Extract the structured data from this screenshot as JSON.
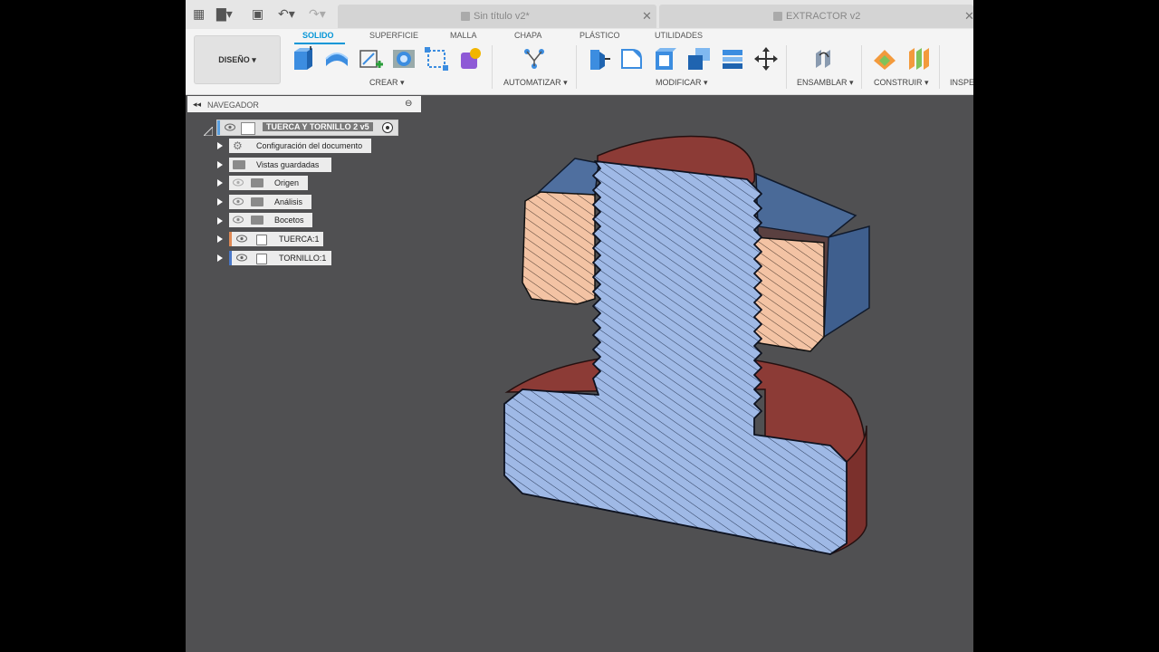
{
  "quick_access": {
    "grid_icon": "grid-icon",
    "file_icon": "file-icon",
    "save_icon": "save-icon",
    "undo_icon": "undo-icon",
    "redo_icon": "redo-icon"
  },
  "tabs": [
    {
      "label": "Sin título v2*",
      "active": false
    },
    {
      "label": "EXTRACTOR v2",
      "active": false
    }
  ],
  "ribbon": {
    "workspace": "DISEÑO",
    "tabs": [
      "SOLIDO",
      "SUPERFICIE",
      "MALLA",
      "CHAPA",
      "PLÁSTICO",
      "UTILIDADES"
    ],
    "active_tab": "SOLIDO",
    "groups": [
      "CREAR",
      "AUTOMATIZAR",
      "MODIFICAR",
      "ENSAMBLAR",
      "CONSTRUIR",
      "INSPEC"
    ]
  },
  "navigator": {
    "title": "NAVEGADOR",
    "root": "TUERCA Y TORNILLO 2 v5",
    "items": [
      {
        "label": "Configuración del documento",
        "icon": "gear-icon"
      },
      {
        "label": "Vistas guardadas",
        "icon": "folder-icon"
      },
      {
        "label": "Origen",
        "icon": "folder-icon"
      },
      {
        "label": "Análisis",
        "icon": "folder-icon"
      },
      {
        "label": "Bocetos",
        "icon": "folder-icon"
      },
      {
        "label": "TUERCA:1",
        "icon": "component-icon",
        "color": "#e08a55"
      },
      {
        "label": "TORNILLO:1",
        "icon": "component-icon",
        "color": "#4a78c8"
      }
    ]
  },
  "colors": {
    "accent": "#0696d7",
    "viewport": "#505052",
    "bolt_section": "#9fb9e6",
    "nut_section": "#f3c3a4",
    "bolt_surface": "#8c3b36",
    "nut_surface": "#4f6f9f"
  }
}
